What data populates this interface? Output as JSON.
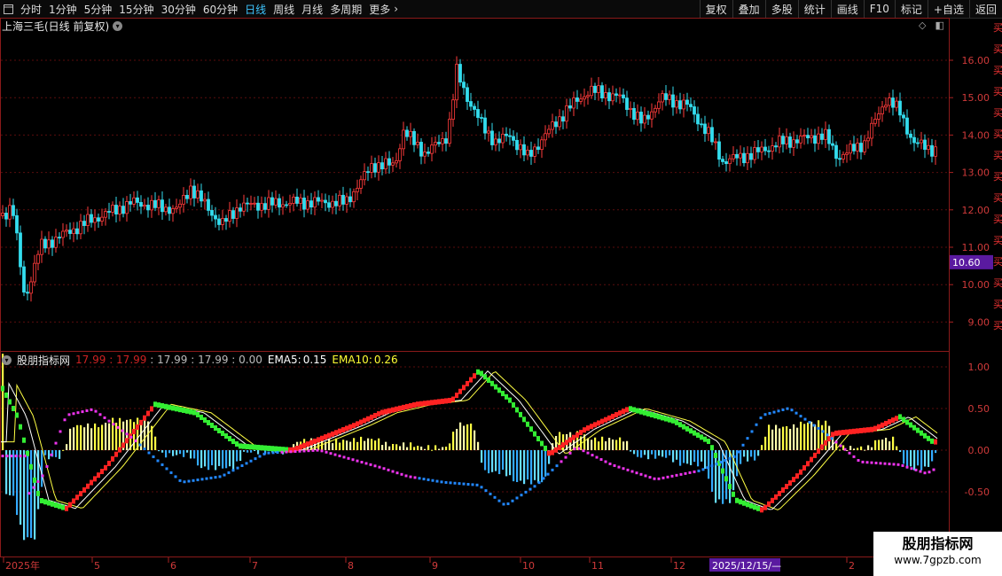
{
  "toolbar": {
    "periods": [
      {
        "label": "分时",
        "active": false
      },
      {
        "label": "1分钟",
        "active": false
      },
      {
        "label": "5分钟",
        "active": false
      },
      {
        "label": "15分钟",
        "active": false
      },
      {
        "label": "30分钟",
        "active": false
      },
      {
        "label": "60分钟",
        "active": false
      },
      {
        "label": "日线",
        "active": true
      },
      {
        "label": "周线",
        "active": false
      },
      {
        "label": "月线",
        "active": false
      },
      {
        "label": "多周期",
        "active": false
      },
      {
        "label": "更多",
        "active": false
      }
    ],
    "actions": [
      "复权",
      "叠加",
      "多股",
      "统计",
      "画线",
      "F10",
      "标记",
      "+自选",
      "返回"
    ]
  },
  "main_chart": {
    "title": "上海三毛(日线 前复权)",
    "price_ticks": [
      "16.00",
      "15.00",
      "14.00",
      "13.00",
      "12.00",
      "11.00",
      "10.00",
      "9.00"
    ],
    "price_marker": "10.60",
    "up_color": "#ff3b3b",
    "down_color": "#33ddee"
  },
  "indicator": {
    "name": "股朋指标网",
    "values": [
      {
        "text": "17.99",
        "color": "#cc2222"
      },
      {
        "text": ": 17.99",
        "color": "#cc2222"
      },
      {
        "text": ": 17.99",
        "color": "#bbbbbb"
      },
      {
        "text": ": 17.99",
        "color": "#bbbbbb"
      },
      {
        "text": ": 0.00",
        "color": "#bbbbbb"
      }
    ],
    "ema5": {
      "label": "EMA5:",
      "value": "0.15",
      "color": "#ffffff"
    },
    "ema10": {
      "label": "EMA10:",
      "value": "0.26",
      "color": "#ffff33"
    },
    "ticks": [
      "1.00",
      "0.50",
      "0.00",
      "-0.50"
    ]
  },
  "time_axis": {
    "labels": [
      "2025年",
      "5",
      "6",
      "7",
      "8",
      "9",
      "10",
      "11",
      "12",
      "2"
    ],
    "cursor_label": "2025/12/15/—"
  },
  "watermark": {
    "title": "股朋指标网",
    "url": "www.7gpzb.com"
  }
}
